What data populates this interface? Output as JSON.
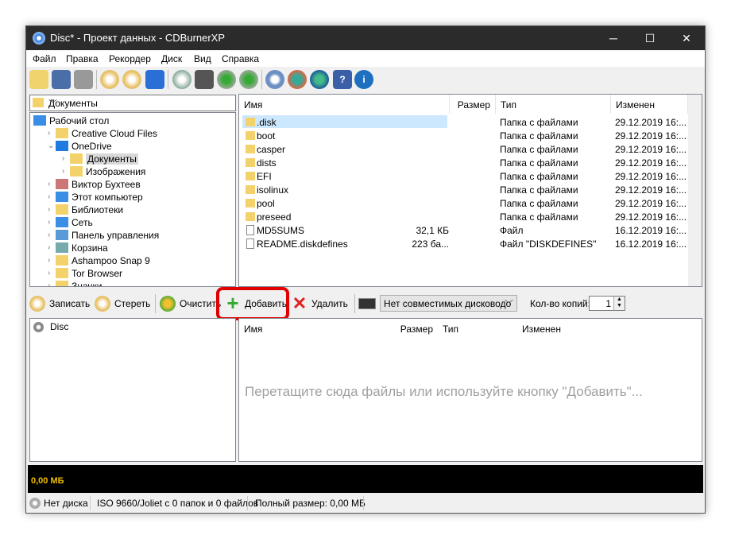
{
  "window": {
    "title": "Disc* - Проект данных - CDBurnerXP",
    "minimize": "─",
    "maximize": "☐",
    "close": "✕"
  },
  "menu": [
    "Файл",
    "Правка",
    "Рекордер",
    "Диск",
    "Вид",
    "Справка"
  ],
  "toolbar_icons": [
    "open-folder",
    "save",
    "print",
    "disc-erase",
    "disc-check",
    "blue-square",
    "disc-info",
    "drive-info",
    "disc-down",
    "disc-up",
    "settings",
    "globe-arrow",
    "globe-cursor",
    "help",
    "info"
  ],
  "folder_combo": {
    "value": "Документы"
  },
  "tree": [
    {
      "label": "Рабочий стол",
      "depth": 0
    },
    {
      "label": "Creative Cloud Files",
      "depth": 1
    },
    {
      "label": "OneDrive",
      "depth": 1,
      "expanded": true
    },
    {
      "label": "Документы",
      "depth": 2,
      "selected": true
    },
    {
      "label": "Изображения",
      "depth": 2
    },
    {
      "label": "Виктор Бухтеев",
      "depth": 1
    },
    {
      "label": "Этот компьютер",
      "depth": 1
    },
    {
      "label": "Библиотеки",
      "depth": 1
    },
    {
      "label": "Сеть",
      "depth": 1
    },
    {
      "label": "Панель управления",
      "depth": 1
    },
    {
      "label": "Корзина",
      "depth": 1
    },
    {
      "label": "Ashampoo Snap 9",
      "depth": 1
    },
    {
      "label": "Tor Browser",
      "depth": 1
    },
    {
      "label": "Значки",
      "depth": 1
    }
  ],
  "file_list": {
    "columns": [
      "Имя",
      "Размер",
      "Тип",
      "Изменен"
    ],
    "rows": [
      {
        "name": ".disk",
        "size": "",
        "type": "Папка с файлами",
        "modified": "29.12.2019 16:...",
        "kind": "folder",
        "selected": true
      },
      {
        "name": "boot",
        "size": "",
        "type": "Папка с файлами",
        "modified": "29.12.2019 16:...",
        "kind": "folder"
      },
      {
        "name": "casper",
        "size": "",
        "type": "Папка с файлами",
        "modified": "29.12.2019 16:...",
        "kind": "folder"
      },
      {
        "name": "dists",
        "size": "",
        "type": "Папка с файлами",
        "modified": "29.12.2019 16:...",
        "kind": "folder"
      },
      {
        "name": "EFI",
        "size": "",
        "type": "Папка с файлами",
        "modified": "29.12.2019 16:...",
        "kind": "folder"
      },
      {
        "name": "isolinux",
        "size": "",
        "type": "Папка с файлами",
        "modified": "29.12.2019 16:...",
        "kind": "folder"
      },
      {
        "name": "pool",
        "size": "",
        "type": "Папка с файлами",
        "modified": "29.12.2019 16:...",
        "kind": "folder"
      },
      {
        "name": "preseed",
        "size": "",
        "type": "Папка с файлами",
        "modified": "29.12.2019 16:...",
        "kind": "folder"
      },
      {
        "name": "MD5SUMS",
        "size": "32,1 КБ",
        "type": "Файл",
        "modified": "16.12.2019 16:...",
        "kind": "file"
      },
      {
        "name": "README.diskdefines",
        "size": "223 ба...",
        "type": "Файл \"DISKDEFINES\"",
        "modified": "16.12.2019 16:...",
        "kind": "file"
      }
    ]
  },
  "actions": {
    "burn": "Записать",
    "erase": "Стереть",
    "clear": "Очистить",
    "add": "Добавить",
    "delete": "Удалить",
    "drive": "Нет совместимых дисководо",
    "copies_label": "Кол-во копий:",
    "copies": "1"
  },
  "project": {
    "root": "Disc",
    "columns": [
      "Имя",
      "Размер",
      "Тип",
      "Изменен"
    ],
    "empty_hint": "Перетащите сюда файлы или используйте кнопку \"Добавить\"..."
  },
  "capacity": {
    "used": "0,00 МБ"
  },
  "status": {
    "disc": "Нет диска",
    "fs": "ISO 9660/Joliet с 0 папок и 0 файлов",
    "total": "Полный размер: 0,00 МБ"
  },
  "colors": {
    "highlight": "#e00000",
    "capacity_text": "#f0c000"
  }
}
